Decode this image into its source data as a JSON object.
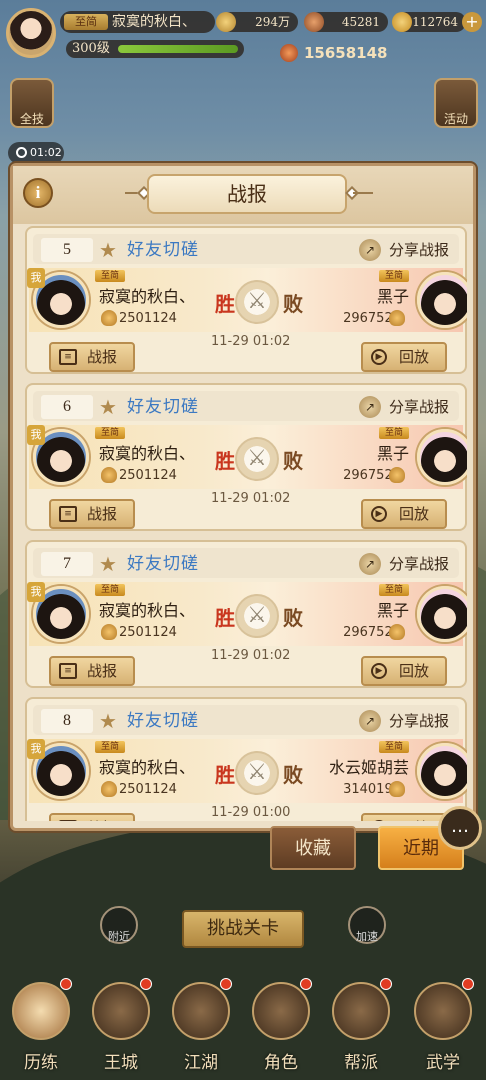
{
  "player": {
    "title_badge": "至简",
    "name": "寂寞的秋白、",
    "level": "300级",
    "power": "15658148"
  },
  "resources": [
    {
      "icon": "coin-icon",
      "value": "294万"
    },
    {
      "icon": "food-icon",
      "value": "45281"
    },
    {
      "icon": "ingot-icon",
      "value": "112764"
    }
  ],
  "side_buttons": {
    "left": "全技",
    "right": "活动"
  },
  "timer": "01:02",
  "dialog": {
    "title": "战报",
    "share_label": "分享战报",
    "report_label": "战报",
    "replay_label": "回放",
    "win_label": "胜",
    "lose_label": "败",
    "me_tag": "我",
    "reports": [
      {
        "index": "5",
        "type": "好友切磋",
        "left_rank": "至简",
        "left_name": "寂寞的秋白、",
        "left_score": "2501124",
        "right_rank": "至简",
        "right_name": "黑子",
        "right_score": "2967525",
        "time": "11-29 01:02"
      },
      {
        "index": "6",
        "type": "好友切磋",
        "left_rank": "至简",
        "left_name": "寂寞的秋白、",
        "left_score": "2501124",
        "right_rank": "至简",
        "right_name": "黑子",
        "right_score": "2967525",
        "time": "11-29 01:02"
      },
      {
        "index": "7",
        "type": "好友切磋",
        "left_rank": "至简",
        "left_name": "寂寞的秋白、",
        "left_score": "2501124",
        "right_rank": "至简",
        "right_name": "黑子",
        "right_score": "2967525",
        "time": "11-29 01:02"
      },
      {
        "index": "8",
        "type": "好友切磋",
        "left_rank": "至简",
        "left_name": "寂寞的秋白、",
        "left_score": "2501124",
        "right_rank": "至简",
        "right_name": "水云姬胡芸",
        "right_score": "3140193",
        "time": "11-29 01:00"
      }
    ]
  },
  "tabs": {
    "collect": "收藏",
    "recent": "近期"
  },
  "game": {
    "challenge": "挑战关卡",
    "near": "附近",
    "speed": "加速"
  },
  "nav": [
    "历练",
    "王城",
    "江湖",
    "角色",
    "帮派",
    "武学"
  ]
}
